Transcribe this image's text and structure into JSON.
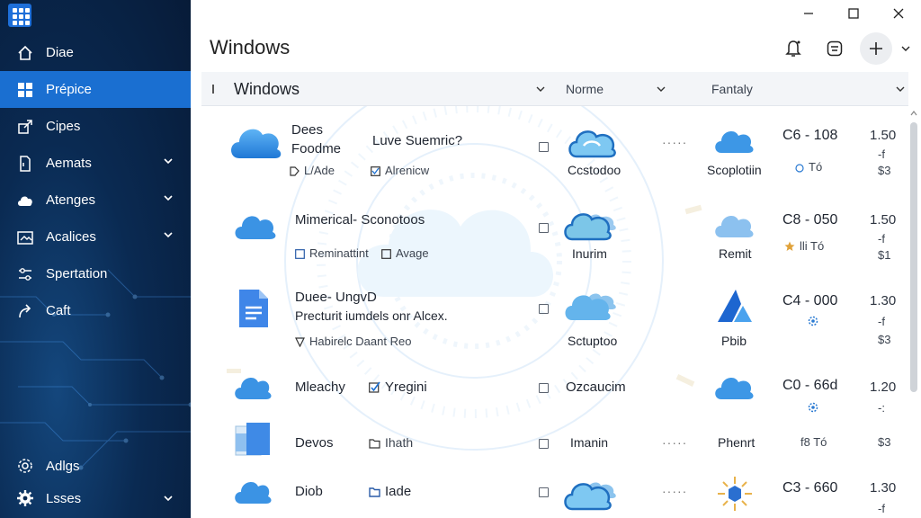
{
  "window": {
    "title": "Windows"
  },
  "sidebar": {
    "items": [
      {
        "label": "Diae",
        "icon": "home-icon"
      },
      {
        "label": "Prépice",
        "icon": "grid-icon",
        "active": true
      },
      {
        "label": "Cipes",
        "icon": "share-icon"
      },
      {
        "label": "Aemats",
        "icon": "document-icon",
        "has_chevron": true
      },
      {
        "label": "Atenges",
        "icon": "cloud-icon",
        "has_chevron": true
      },
      {
        "label": "Acalices",
        "icon": "image-icon",
        "has_chevron": true
      },
      {
        "label": "Spertation",
        "icon": "sliders-icon"
      },
      {
        "label": "Caft",
        "icon": "arrow-share-icon"
      }
    ],
    "bottom_items": [
      {
        "label": "Adlgs",
        "icon": "settings-icon"
      },
      {
        "label": "Lsses",
        "icon": "gear-icon",
        "has_chevron": true
      }
    ]
  },
  "header": {
    "title": "Windows",
    "col_norme": "Norme",
    "col_fantaly": "Fantaly"
  },
  "rows": [
    {
      "title_a": "Dees",
      "title_b": "Foodme",
      "extra": "Luve Suemric?",
      "sub_a": "L/Ade",
      "sub_b": "Alrenicw",
      "col3": "Ccstodoo",
      "col5": "Scoplotiin",
      "code": "C6 - 108",
      "code_sub": "Tó",
      "price": "1.50",
      "price_sub1": "-f",
      "price_sub2": "$3"
    },
    {
      "title_a": "Mimerical- Sconotoos",
      "sub_a": "Reminattint",
      "sub_b": "Avage",
      "col3": "Inurim",
      "col5": "Remit",
      "code": "C8 - 050",
      "code_sub": "lli Tó",
      "price": "1.50",
      "price_sub1": "-f",
      "price_sub2": "$1"
    },
    {
      "title_a": "Duee- UngvD",
      "title_b": "Precturit iumdels onr Alcex.",
      "sub_a": "Habirelc Daant Reo",
      "col3": "Sctuptoo",
      "col5": "Pbib",
      "code": "C4 - 000",
      "price": "1.30",
      "price_sub1": "-f",
      "price_sub2": "$3"
    },
    {
      "title_a": "Mleachy",
      "sub_b": "Yregini",
      "col3": "Ozcaucim",
      "code": "C0 - 66d",
      "price": "1.20",
      "price_sub1": "-:"
    },
    {
      "title_a": "Devos",
      "sub_b": "Ihath",
      "col3": "Imanin",
      "col5": "Phenrt",
      "code_sub": "f8 Tó",
      "price_sub2": "$3"
    },
    {
      "title_a": "Diob",
      "sub_b": "Iade",
      "code": "C3 - 660",
      "price": "1.30",
      "price_sub1": "-f"
    }
  ],
  "colors": {
    "sidebar_bg": "#0a2a52",
    "active": "#1a6fd1",
    "cloud": "#2f8fe0"
  }
}
